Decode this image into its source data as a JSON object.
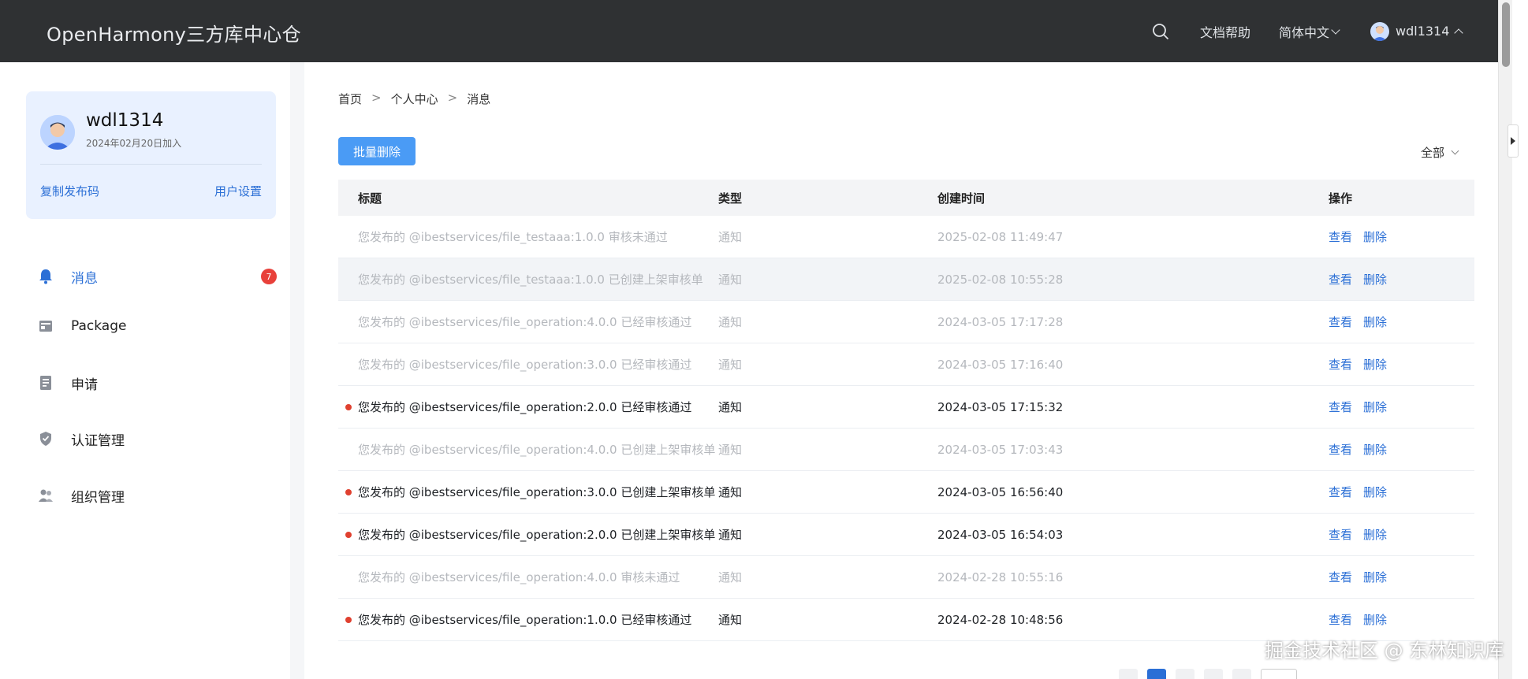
{
  "header": {
    "brand": "OpenHarmony三方库中心仓",
    "docs": "文档帮助",
    "language": "简体中文",
    "username": "wdl1314"
  },
  "profile": {
    "name": "wdl1314",
    "joined": "2024年02月20日加入",
    "copy_code": "复制发布码",
    "settings": "用户设置"
  },
  "menu": [
    {
      "label": "消息",
      "icon": "bell-icon",
      "badge": "7"
    },
    {
      "label": "Package",
      "icon": "package-icon"
    },
    {
      "label": "申请",
      "icon": "document-icon"
    },
    {
      "label": "认证管理",
      "icon": "shield-icon"
    },
    {
      "label": "组织管理",
      "icon": "group-icon"
    }
  ],
  "breadcrumb": [
    "首页",
    ">",
    "个人中心",
    ">",
    "消息"
  ],
  "toolbar": {
    "batch_delete": "批量删除",
    "filter": "全部"
  },
  "table": {
    "headers": [
      "标题",
      "类型",
      "创建时间",
      "操作"
    ],
    "ops": [
      "查看",
      "删除"
    ],
    "rows": [
      {
        "title": "您发布的 @ibestservices/file_testaaa:1.0.0 审核未通过",
        "type": "通知",
        "time": "2025-02-08 11:49:47",
        "unread": false
      },
      {
        "title": "您发布的 @ibestservices/file_testaaa:1.0.0 已创建上架审核单",
        "type": "通知",
        "time": "2025-02-08 10:55:28",
        "unread": false
      },
      {
        "title": "您发布的 @ibestservices/file_operation:4.0.0 已经审核通过",
        "type": "通知",
        "time": "2024-03-05 17:17:28",
        "unread": false
      },
      {
        "title": "您发布的 @ibestservices/file_operation:3.0.0 已经审核通过",
        "type": "通知",
        "time": "2024-03-05 17:16:40",
        "unread": false
      },
      {
        "title": "您发布的 @ibestservices/file_operation:2.0.0 已经审核通过",
        "type": "通知",
        "time": "2024-03-05 17:15:32",
        "unread": true
      },
      {
        "title": "您发布的 @ibestservices/file_operation:4.0.0 已创建上架审核单",
        "type": "通知",
        "time": "2024-03-05 17:03:43",
        "unread": false
      },
      {
        "title": "您发布的 @ibestservices/file_operation:3.0.0 已创建上架审核单",
        "type": "通知",
        "time": "2024-03-05 16:56:40",
        "unread": true
      },
      {
        "title": "您发布的 @ibestservices/file_operation:2.0.0 已创建上架审核单",
        "type": "通知",
        "time": "2024-03-05 16:54:03",
        "unread": true
      },
      {
        "title": "您发布的 @ibestservices/file_operation:4.0.0 审核未通过",
        "type": "通知",
        "time": "2024-02-28 10:55:16",
        "unread": false
      },
      {
        "title": "您发布的 @ibestservices/file_operation:1.0.0 已经审核通过",
        "type": "通知",
        "time": "2024-02-28 10:48:56",
        "unread": true
      }
    ]
  },
  "watermark": "掘金技术社区 @ 东林知识库",
  "colors": {
    "accent": "#2b6fd6",
    "header_bg": "#2f3133",
    "unread_dot": "#e0402f",
    "badge": "#e8403a"
  }
}
